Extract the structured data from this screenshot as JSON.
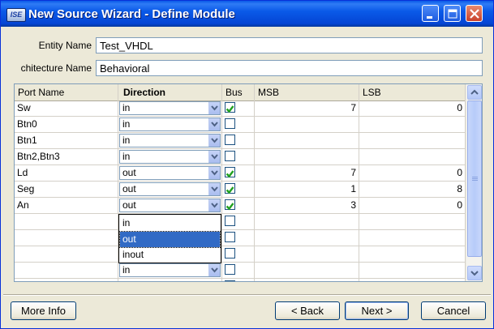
{
  "window": {
    "title": "New Source Wizard - Define Module",
    "app_badge": "ISE"
  },
  "form": {
    "entity_label": "Entity Name",
    "entity_value": "Test_VHDL",
    "architecture_label": "chitecture Name",
    "architecture_value": "Behavioral"
  },
  "grid": {
    "headers": [
      "Port Name",
      "Direction",
      "Bus",
      "MSB",
      "LSB"
    ],
    "rows": [
      {
        "port": "Sw",
        "direction": "in",
        "bus": true,
        "msb": "7",
        "lsb": "0"
      },
      {
        "port": "Btn0",
        "direction": "in",
        "bus": false,
        "msb": "",
        "lsb": ""
      },
      {
        "port": "Btn1",
        "direction": "in",
        "bus": false,
        "msb": "",
        "lsb": ""
      },
      {
        "port": "Btn2,Btn3",
        "direction": "in",
        "bus": false,
        "msb": "",
        "lsb": ""
      },
      {
        "port": "Ld",
        "direction": "out",
        "bus": true,
        "msb": "7",
        "lsb": "0"
      },
      {
        "port": "Seg",
        "direction": "out",
        "bus": true,
        "msb": "1",
        "lsb": "8"
      },
      {
        "port": "An",
        "direction": "out",
        "bus": true,
        "msb": "3",
        "lsb": "0"
      },
      {
        "port": "",
        "direction": "",
        "bus": false,
        "msb": "",
        "lsb": ""
      },
      {
        "port": "",
        "direction": "",
        "bus": false,
        "msb": "",
        "lsb": ""
      },
      {
        "port": "",
        "direction": "",
        "bus": false,
        "msb": "",
        "lsb": ""
      },
      {
        "port": "",
        "direction": "in",
        "bus": false,
        "msb": "",
        "lsb": ""
      },
      {
        "port": "",
        "direction": "",
        "bus": false,
        "msb": "",
        "lsb": ""
      }
    ],
    "dropdown_options": [
      "in",
      "out",
      "inout"
    ],
    "dropdown_selected": "out"
  },
  "buttons": {
    "more_info": "More Info",
    "back": "< Back",
    "next": "Next >",
    "cancel": "Cancel"
  },
  "colors": {
    "titlebar": "#0a5ae8",
    "selection": "#316ac5",
    "check": "#21a121"
  }
}
